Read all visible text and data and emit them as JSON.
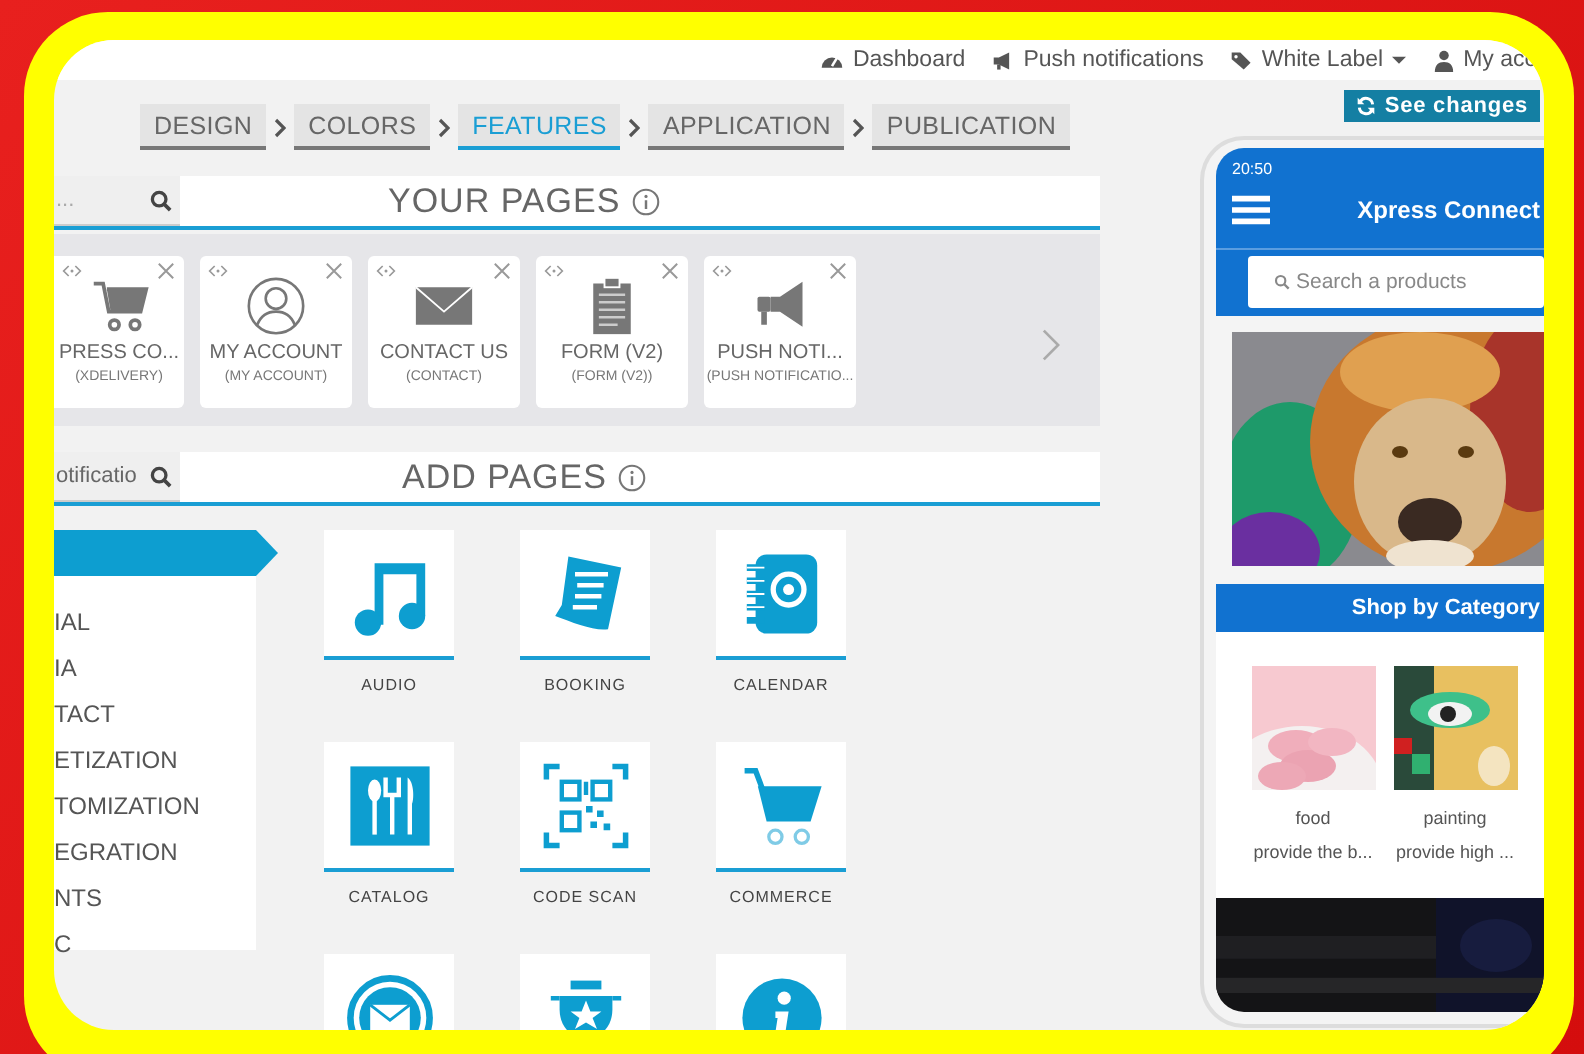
{
  "top_nav": [
    {
      "label": "Dashboard",
      "kind": "gauge"
    },
    {
      "label": "Push notifications",
      "kind": "megaphone"
    },
    {
      "label": "White Label",
      "kind": "tags",
      "dropdown": true
    },
    {
      "label": "My acc",
      "kind": "user"
    }
  ],
  "stepper": [
    {
      "label": "DESIGN",
      "selected": false
    },
    {
      "label": "COLORS",
      "selected": false
    },
    {
      "label": "FEATURES",
      "selected": true
    },
    {
      "label": "APPLICATION",
      "selected": false
    },
    {
      "label": "PUBLICATION",
      "selected": false
    }
  ],
  "see_changes": {
    "label": "See changes"
  },
  "your_pages": {
    "title": "YOUR PAGES",
    "search": {
      "placeholder": "..."
    },
    "pages": [
      {
        "title": "PRESS CO...",
        "subtitle": "(XDELIVERY)",
        "kind": "cart"
      },
      {
        "title": "MY ACCOUNT",
        "subtitle": "(MY ACCOUNT)",
        "kind": "person"
      },
      {
        "title": "CONTACT US",
        "subtitle": "(CONTACT)",
        "kind": "envelope"
      },
      {
        "title": "FORM (V2)",
        "subtitle": "(FORM (V2))",
        "kind": "clipboard"
      },
      {
        "title": "PUSH NOTI...",
        "subtitle": "(PUSH NOTIFICATIO...",
        "kind": "megaphone"
      }
    ]
  },
  "add_pages": {
    "title": "ADD PAGES",
    "search": {
      "value": "otificatio"
    },
    "categories": [
      {
        "selected": true
      },
      {
        "label": "IAL",
        "selected": false
      },
      {
        "label": "IA",
        "selected": false
      },
      {
        "label": "TACT",
        "selected": false
      },
      {
        "label": "ETIZATION",
        "selected": false
      },
      {
        "label": "TOMIZATION",
        "selected": false
      },
      {
        "label": "EGRATION",
        "selected": false
      },
      {
        "label": "NTS",
        "selected": false
      },
      {
        "label": "C",
        "selected": false
      }
    ],
    "tiles": [
      {
        "label": "AUDIO",
        "kind": "music"
      },
      {
        "label": "BOOKING",
        "kind": "document"
      },
      {
        "label": "CALENDAR",
        "kind": "book"
      },
      {
        "label": "CATALOG",
        "kind": "cutlery"
      },
      {
        "label": "CODE SCAN",
        "kind": "qr"
      },
      {
        "label": "COMMERCE",
        "kind": "cart"
      },
      {
        "kind": "mail"
      },
      {
        "kind": "trophy"
      },
      {
        "kind": "info"
      }
    ]
  },
  "phone": {
    "time": "20:50",
    "title": "Xpress Connect",
    "search": {
      "placeholder": "Search a products"
    },
    "category_bar": "Shop by Category",
    "categories": [
      {
        "name": "food",
        "description": "provide the b...",
        "kind": "macarons"
      },
      {
        "name": "painting",
        "description": "provide high ...",
        "kind": "painting"
      }
    ]
  }
}
